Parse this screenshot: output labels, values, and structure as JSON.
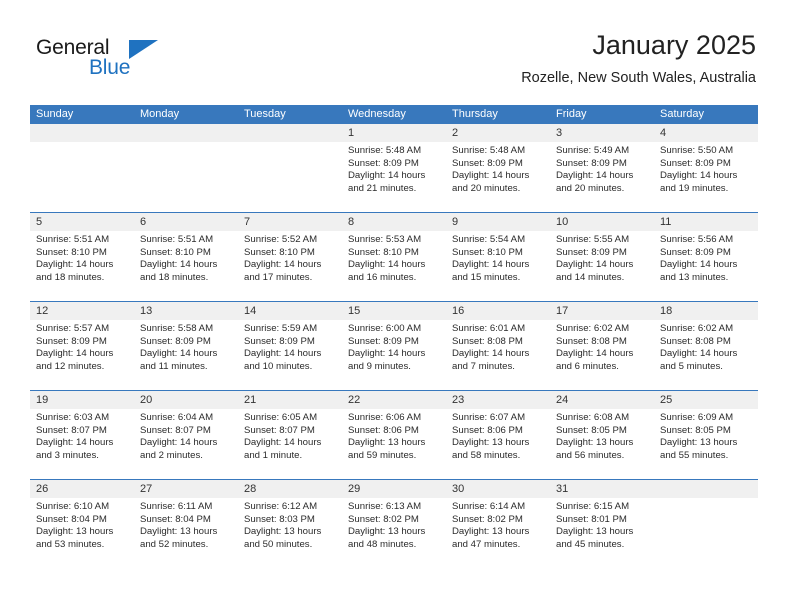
{
  "brand": {
    "name_top": "General",
    "name_bottom": "Blue",
    "accent_color": "#1f72c0"
  },
  "header": {
    "month_title": "January 2025",
    "location": "Rozelle, New South Wales, Australia"
  },
  "calendar": {
    "header_bg": "#3878bd",
    "day_strip_bg": "#f0f0f0",
    "weekdays": [
      "Sunday",
      "Monday",
      "Tuesday",
      "Wednesday",
      "Thursday",
      "Friday",
      "Saturday"
    ],
    "weeks": [
      [
        {
          "empty": true
        },
        {
          "empty": true
        },
        {
          "empty": true
        },
        {
          "day": "1",
          "sunrise": "Sunrise: 5:48 AM",
          "sunset": "Sunset: 8:09 PM",
          "daylight_1": "Daylight: 14 hours",
          "daylight_2": "and 21 minutes."
        },
        {
          "day": "2",
          "sunrise": "Sunrise: 5:48 AM",
          "sunset": "Sunset: 8:09 PM",
          "daylight_1": "Daylight: 14 hours",
          "daylight_2": "and 20 minutes."
        },
        {
          "day": "3",
          "sunrise": "Sunrise: 5:49 AM",
          "sunset": "Sunset: 8:09 PM",
          "daylight_1": "Daylight: 14 hours",
          "daylight_2": "and 20 minutes."
        },
        {
          "day": "4",
          "sunrise": "Sunrise: 5:50 AM",
          "sunset": "Sunset: 8:09 PM",
          "daylight_1": "Daylight: 14 hours",
          "daylight_2": "and 19 minutes."
        }
      ],
      [
        {
          "day": "5",
          "sunrise": "Sunrise: 5:51 AM",
          "sunset": "Sunset: 8:10 PM",
          "daylight_1": "Daylight: 14 hours",
          "daylight_2": "and 18 minutes."
        },
        {
          "day": "6",
          "sunrise": "Sunrise: 5:51 AM",
          "sunset": "Sunset: 8:10 PM",
          "daylight_1": "Daylight: 14 hours",
          "daylight_2": "and 18 minutes."
        },
        {
          "day": "7",
          "sunrise": "Sunrise: 5:52 AM",
          "sunset": "Sunset: 8:10 PM",
          "daylight_1": "Daylight: 14 hours",
          "daylight_2": "and 17 minutes."
        },
        {
          "day": "8",
          "sunrise": "Sunrise: 5:53 AM",
          "sunset": "Sunset: 8:10 PM",
          "daylight_1": "Daylight: 14 hours",
          "daylight_2": "and 16 minutes."
        },
        {
          "day": "9",
          "sunrise": "Sunrise: 5:54 AM",
          "sunset": "Sunset: 8:10 PM",
          "daylight_1": "Daylight: 14 hours",
          "daylight_2": "and 15 minutes."
        },
        {
          "day": "10",
          "sunrise": "Sunrise: 5:55 AM",
          "sunset": "Sunset: 8:09 PM",
          "daylight_1": "Daylight: 14 hours",
          "daylight_2": "and 14 minutes."
        },
        {
          "day": "11",
          "sunrise": "Sunrise: 5:56 AM",
          "sunset": "Sunset: 8:09 PM",
          "daylight_1": "Daylight: 14 hours",
          "daylight_2": "and 13 minutes."
        }
      ],
      [
        {
          "day": "12",
          "sunrise": "Sunrise: 5:57 AM",
          "sunset": "Sunset: 8:09 PM",
          "daylight_1": "Daylight: 14 hours",
          "daylight_2": "and 12 minutes."
        },
        {
          "day": "13",
          "sunrise": "Sunrise: 5:58 AM",
          "sunset": "Sunset: 8:09 PM",
          "daylight_1": "Daylight: 14 hours",
          "daylight_2": "and 11 minutes."
        },
        {
          "day": "14",
          "sunrise": "Sunrise: 5:59 AM",
          "sunset": "Sunset: 8:09 PM",
          "daylight_1": "Daylight: 14 hours",
          "daylight_2": "and 10 minutes."
        },
        {
          "day": "15",
          "sunrise": "Sunrise: 6:00 AM",
          "sunset": "Sunset: 8:09 PM",
          "daylight_1": "Daylight: 14 hours",
          "daylight_2": "and 9 minutes."
        },
        {
          "day": "16",
          "sunrise": "Sunrise: 6:01 AM",
          "sunset": "Sunset: 8:08 PM",
          "daylight_1": "Daylight: 14 hours",
          "daylight_2": "and 7 minutes."
        },
        {
          "day": "17",
          "sunrise": "Sunrise: 6:02 AM",
          "sunset": "Sunset: 8:08 PM",
          "daylight_1": "Daylight: 14 hours",
          "daylight_2": "and 6 minutes."
        },
        {
          "day": "18",
          "sunrise": "Sunrise: 6:02 AM",
          "sunset": "Sunset: 8:08 PM",
          "daylight_1": "Daylight: 14 hours",
          "daylight_2": "and 5 minutes."
        }
      ],
      [
        {
          "day": "19",
          "sunrise": "Sunrise: 6:03 AM",
          "sunset": "Sunset: 8:07 PM",
          "daylight_1": "Daylight: 14 hours",
          "daylight_2": "and 3 minutes."
        },
        {
          "day": "20",
          "sunrise": "Sunrise: 6:04 AM",
          "sunset": "Sunset: 8:07 PM",
          "daylight_1": "Daylight: 14 hours",
          "daylight_2": "and 2 minutes."
        },
        {
          "day": "21",
          "sunrise": "Sunrise: 6:05 AM",
          "sunset": "Sunset: 8:07 PM",
          "daylight_1": "Daylight: 14 hours",
          "daylight_2": "and 1 minute."
        },
        {
          "day": "22",
          "sunrise": "Sunrise: 6:06 AM",
          "sunset": "Sunset: 8:06 PM",
          "daylight_1": "Daylight: 13 hours",
          "daylight_2": "and 59 minutes."
        },
        {
          "day": "23",
          "sunrise": "Sunrise: 6:07 AM",
          "sunset": "Sunset: 8:06 PM",
          "daylight_1": "Daylight: 13 hours",
          "daylight_2": "and 58 minutes."
        },
        {
          "day": "24",
          "sunrise": "Sunrise: 6:08 AM",
          "sunset": "Sunset: 8:05 PM",
          "daylight_1": "Daylight: 13 hours",
          "daylight_2": "and 56 minutes."
        },
        {
          "day": "25",
          "sunrise": "Sunrise: 6:09 AM",
          "sunset": "Sunset: 8:05 PM",
          "daylight_1": "Daylight: 13 hours",
          "daylight_2": "and 55 minutes."
        }
      ],
      [
        {
          "day": "26",
          "sunrise": "Sunrise: 6:10 AM",
          "sunset": "Sunset: 8:04 PM",
          "daylight_1": "Daylight: 13 hours",
          "daylight_2": "and 53 minutes."
        },
        {
          "day": "27",
          "sunrise": "Sunrise: 6:11 AM",
          "sunset": "Sunset: 8:04 PM",
          "daylight_1": "Daylight: 13 hours",
          "daylight_2": "and 52 minutes."
        },
        {
          "day": "28",
          "sunrise": "Sunrise: 6:12 AM",
          "sunset": "Sunset: 8:03 PM",
          "daylight_1": "Daylight: 13 hours",
          "daylight_2": "and 50 minutes."
        },
        {
          "day": "29",
          "sunrise": "Sunrise: 6:13 AM",
          "sunset": "Sunset: 8:02 PM",
          "daylight_1": "Daylight: 13 hours",
          "daylight_2": "and 48 minutes."
        },
        {
          "day": "30",
          "sunrise": "Sunrise: 6:14 AM",
          "sunset": "Sunset: 8:02 PM",
          "daylight_1": "Daylight: 13 hours",
          "daylight_2": "and 47 minutes."
        },
        {
          "day": "31",
          "sunrise": "Sunrise: 6:15 AM",
          "sunset": "Sunset: 8:01 PM",
          "daylight_1": "Daylight: 13 hours",
          "daylight_2": "and 45 minutes."
        },
        {
          "empty": true
        }
      ]
    ]
  }
}
